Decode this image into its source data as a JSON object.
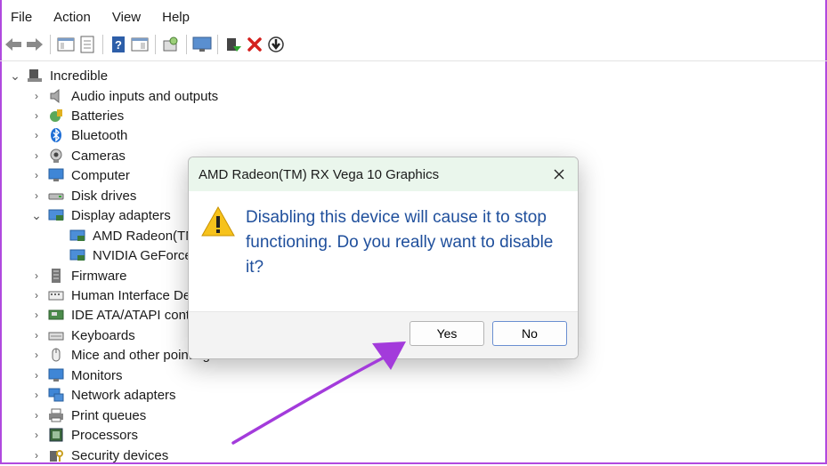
{
  "menu": [
    "File",
    "Action",
    "View",
    "Help"
  ],
  "toolbar_icons": [
    "back-icon",
    "forward-icon",
    "show-hide-console-tree-icon",
    "properties-icon",
    "help-icon",
    "action-pane-icon",
    "scan-hardware-icon",
    "monitor-icon",
    "enable-device-icon",
    "uninstall-device-icon",
    "disable-device-icon"
  ],
  "tree": {
    "root": "Incredible",
    "items": [
      {
        "label": "Audio inputs and outputs",
        "icon": "speaker-icon"
      },
      {
        "label": "Batteries",
        "icon": "battery-icon"
      },
      {
        "label": "Bluetooth",
        "icon": "bluetooth-icon"
      },
      {
        "label": "Cameras",
        "icon": "camera-icon"
      },
      {
        "label": "Computer",
        "icon": "computer-icon"
      },
      {
        "label": "Disk drives",
        "icon": "disk-drive-icon"
      },
      {
        "label": "Display adapters",
        "icon": "display-adapter-icon"
      },
      {
        "label": "AMD Radeon(TM",
        "icon": "display-adapter-icon"
      },
      {
        "label": "NVIDIA GeForce",
        "icon": "display-adapter-icon"
      },
      {
        "label": "Firmware",
        "icon": "firmware-icon"
      },
      {
        "label": "Human Interface De",
        "icon": "hid-icon"
      },
      {
        "label": "IDE ATA/ATAPI contro",
        "icon": "ide-controller-icon"
      },
      {
        "label": "Keyboards",
        "icon": "keyboard-icon"
      },
      {
        "label": "Mice and other pointing devices",
        "icon": "mouse-icon"
      },
      {
        "label": "Monitors",
        "icon": "monitor-icon"
      },
      {
        "label": "Network adapters",
        "icon": "network-adapter-icon"
      },
      {
        "label": "Print queues",
        "icon": "printer-icon"
      },
      {
        "label": "Processors",
        "icon": "processor-icon"
      },
      {
        "label": "Security devices",
        "icon": "security-device-icon"
      }
    ]
  },
  "dialog": {
    "title": "AMD Radeon(TM) RX Vega 10 Graphics",
    "message": "Disabling this device will cause it to stop functioning. Do you really want to disable it?",
    "yes_label": "Yes",
    "no_label": "No"
  },
  "colors": {
    "accent_border": "#b04adf",
    "annotation_arrow": "#a33bdb",
    "message_text": "#1f4f9c",
    "dialog_title_bg": "#eaf6ec"
  }
}
